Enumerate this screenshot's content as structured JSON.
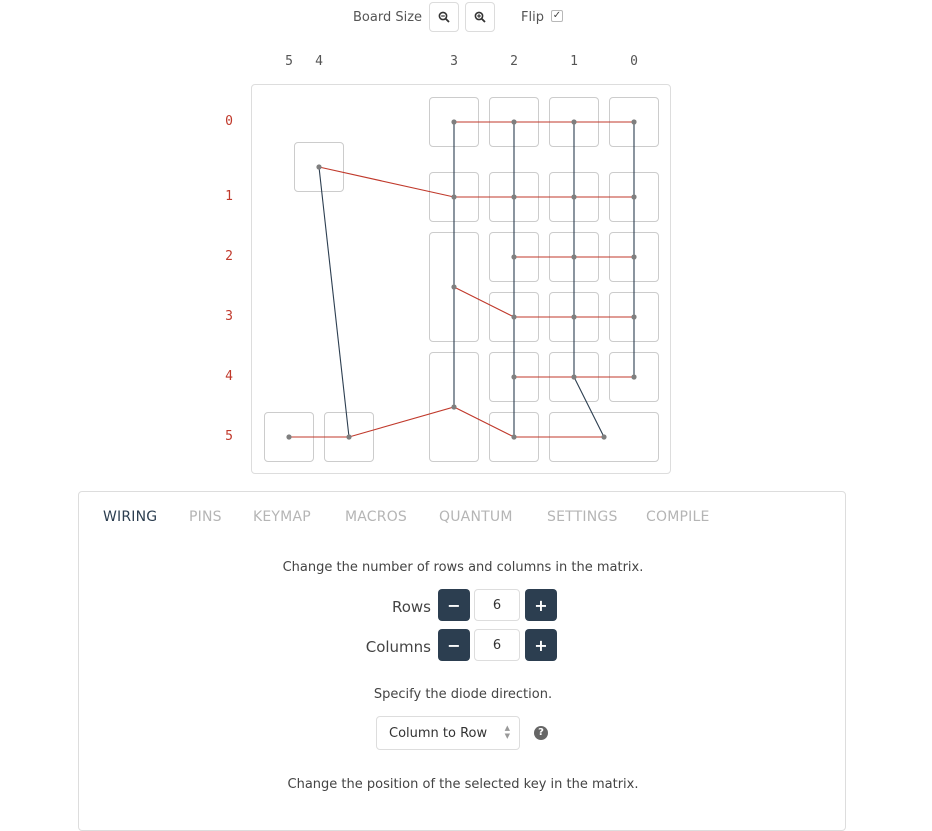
{
  "toolbar": {
    "board_size_label": "Board Size",
    "zoom_out_icon": "zoom-out-icon",
    "zoom_in_icon": "zoom-in-icon",
    "flip_label": "Flip",
    "flip_checked": true,
    "check_mark": "✓"
  },
  "matrix": {
    "column_labels": [
      "5",
      "4",
      "3",
      "2",
      "1",
      "0"
    ],
    "row_labels": [
      "0",
      "1",
      "2",
      "3",
      "4",
      "5"
    ],
    "colors": {
      "row_wire": "#c0392b",
      "column_wire": "#2c3e50",
      "node": "#7f7f7f",
      "row_label": "#c0392b"
    }
  },
  "tabs": [
    "WIRING",
    "PINS",
    "KEYMAP",
    "MACROS",
    "QUANTUM",
    "SETTINGS",
    "COMPILE"
  ],
  "active_tab": "WIRING",
  "wiring": {
    "matrix_instruction": "Change the number of rows and columns in the matrix.",
    "rows_label": "Rows",
    "rows_value": "6",
    "columns_label": "Columns",
    "columns_value": "6",
    "minus_symbol": "−",
    "plus_symbol": "+",
    "diode_instruction": "Specify the diode direction.",
    "diode_direction": "Column to Row",
    "diode_options": [
      "Column to Row"
    ],
    "help_icon": "question-circle-icon",
    "help_glyph": "?",
    "position_instruction": "Change the position of the selected key in the matrix."
  },
  "accent_color": "#2c3e50"
}
